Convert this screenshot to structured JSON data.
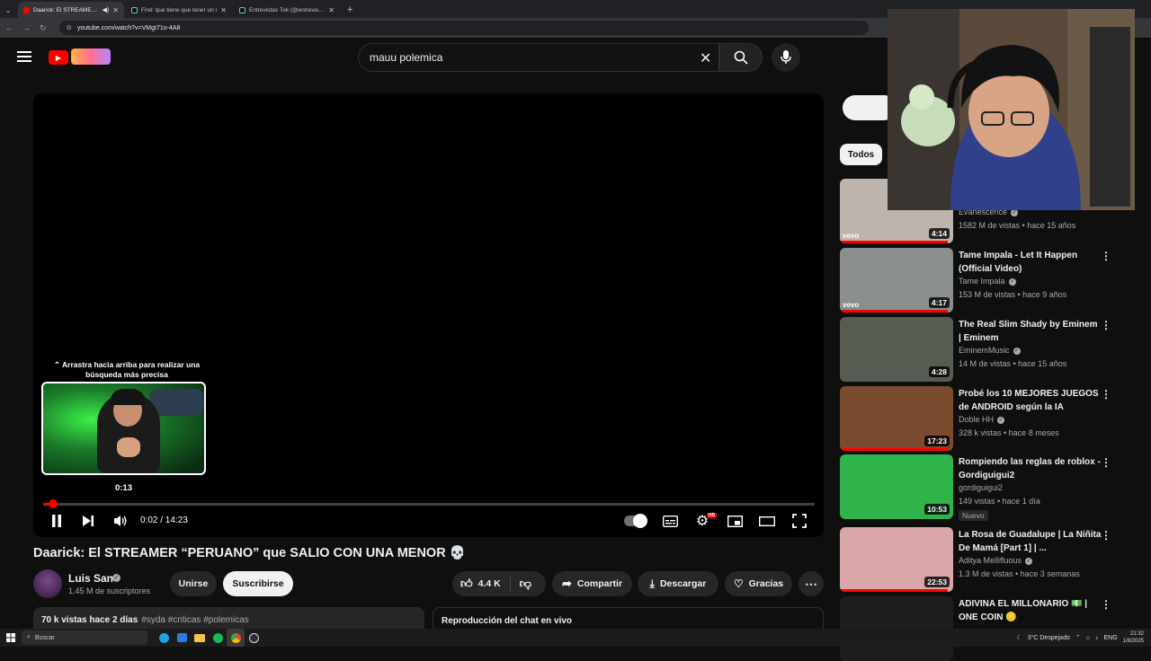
{
  "browser": {
    "tabs": [
      {
        "title": "Daarick: El STREAMER \"PERU",
        "icon": "youtube-favicon"
      },
      {
        "title": "Find 'que tiene que tener un l",
        "icon": "tiktok-favicon"
      },
      {
        "title": "Entrevistas Tok (@entrevistastc",
        "icon": "tiktok-favicon"
      }
    ],
    "url": "youtube.com/watch?v=VMgt71o-4A8"
  },
  "youtube": {
    "search_value": "mauu polemica"
  },
  "player": {
    "hint_text": "⌃ Arrastra hacia arriba para realizar una búsqueda más precisa",
    "preview_time": "0:13",
    "timecode": "0:02 / 14:23",
    "progress_fraction": 0.0023,
    "hd_badge": "HD"
  },
  "video": {
    "title": "Daarick: El STREAMER “PERUANO” que SALIO CON UNA MENOR 💀",
    "channel_name": "Luis San",
    "subscribers": "1.45 M de suscriptores",
    "join_label": "Unirse",
    "subscribe_label": "Suscribirse",
    "likes": "4.4 K",
    "share_label": "Compartir",
    "download_label": "Descargar",
    "thanks_label": "Gracias",
    "desc_stats": "70 k vistas  hace 2 días",
    "desc_tags": "#syda #criticas #polemicas",
    "chat_label": "Reproducción del chat en vivo"
  },
  "sidebar": {
    "chip_all": "Todos",
    "recommendations": [
      {
        "title": "",
        "channel": "Evanescence",
        "meta": "1582 M de vistas • hace 15 años",
        "duration": "4:14",
        "vevo": "vevo",
        "verified": true,
        "progress": 0.95,
        "bg": "#bcb4ad"
      },
      {
        "title": "Tame Impala - Let It Happen (Official Video)",
        "channel": "Tame Impala",
        "meta": "153 M de vistas • hace 9 años",
        "duration": "4:17",
        "vevo": "vevo",
        "verified": true,
        "progress": 0.95,
        "bg": "#8a8f8c"
      },
      {
        "title": "The Real Slim Shady by Eminem | Eminem",
        "channel": "EminemMusic",
        "meta": "14 M de vistas • hace 15 años",
        "duration": "4:28",
        "vevo": "",
        "verified": true,
        "progress": 0,
        "bg": "#565c52"
      },
      {
        "title": "Probé los 10 MEJORES JUEGOS de ANDROID según la IA",
        "channel": "Doble HH",
        "meta": "328 k vistas • hace 8 meses",
        "duration": "17:23",
        "vevo": "",
        "verified": true,
        "progress": 0.95,
        "bg": "#7a4b2e"
      },
      {
        "title": "Rompiendo las reglas de roblox - Gordiguigui2",
        "channel": "gordiguigui2",
        "meta": "149 vistas • hace 1 día",
        "duration": "10:53",
        "vevo": "",
        "verified": false,
        "badge": "Nuevo",
        "progress": 0,
        "bg": "#2fb34a"
      },
      {
        "title": "La Rosa de Guadalupe | La Niñita De Mamá [Part 1] | ...",
        "channel": "Aditya Mellifluous",
        "meta": "1.3 M de vistas • hace 3 semanas",
        "duration": "22:53",
        "vevo": "",
        "verified": true,
        "progress": 0.95,
        "bg": "#d9a7a7"
      },
      {
        "title": "ADIVINA EL MILLONARIO 💵 | ONE COIN 🪙",
        "channel": "",
        "meta": "",
        "duration": "",
        "vevo": "",
        "verified": false,
        "progress": 0,
        "bg": "#1e1e1e"
      }
    ]
  },
  "taskbar": {
    "search_placeholder": "Buscar",
    "weather": "3°C  Despejado",
    "lang": "ENG",
    "time": "21:32",
    "date": "1/8/2025"
  },
  "colors": {
    "accent": "#ff0000",
    "background": "#0f0f0f"
  }
}
